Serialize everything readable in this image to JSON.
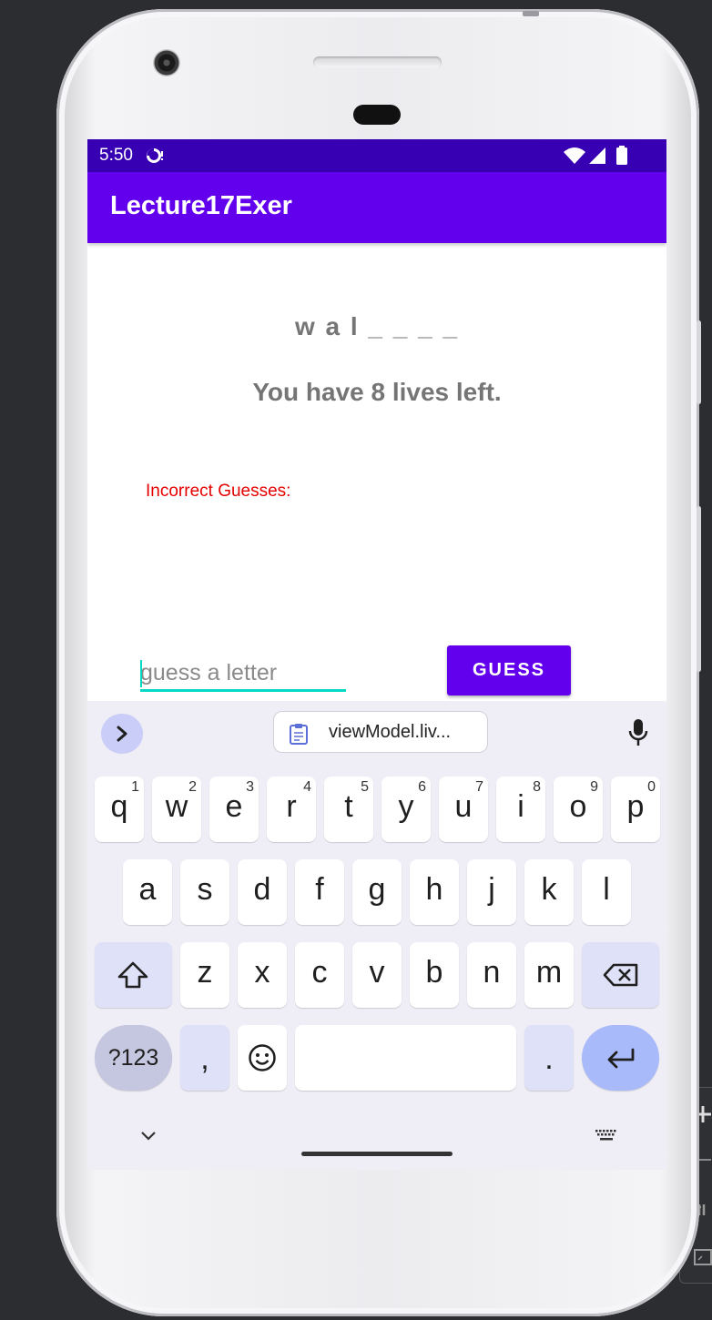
{
  "status_bar": {
    "time": "5:50"
  },
  "app_bar": {
    "title": "Lecture17Exer"
  },
  "game": {
    "word_display": "w a l _ _ _ _",
    "lives_text": "You have 8 lives left.",
    "incorrect_label": "Incorrect Guesses:"
  },
  "guess": {
    "placeholder": "guess a letter",
    "value": "",
    "button_label": "GUESS"
  },
  "keyboard": {
    "clipboard_suggestion": "viewModel.liv...",
    "row1": [
      {
        "char": "q",
        "hint": "1"
      },
      {
        "char": "w",
        "hint": "2"
      },
      {
        "char": "e",
        "hint": "3"
      },
      {
        "char": "r",
        "hint": "4"
      },
      {
        "char": "t",
        "hint": "5"
      },
      {
        "char": "y",
        "hint": "6"
      },
      {
        "char": "u",
        "hint": "7"
      },
      {
        "char": "i",
        "hint": "8"
      },
      {
        "char": "o",
        "hint": "9"
      },
      {
        "char": "p",
        "hint": "0"
      }
    ],
    "row2": [
      "a",
      "s",
      "d",
      "f",
      "g",
      "h",
      "j",
      "k",
      "l"
    ],
    "row3": [
      "z",
      "x",
      "c",
      "v",
      "b",
      "n",
      "m"
    ],
    "symbols_label": "?123",
    "comma": ",",
    "period": "."
  },
  "colors": {
    "status_bar": "#3700b3",
    "primary": "#6200ee",
    "accent": "#03dac5",
    "incorrect_label": "#e50000"
  },
  "icons": {
    "status": [
      "data-saver-icon",
      "wifi-icon",
      "cell-signal-icon",
      "battery-icon"
    ],
    "keyboard": [
      "expand-toolbar-icon",
      "clipboard-icon",
      "mic-icon",
      "shift-icon",
      "backspace-icon",
      "emoji-icon",
      "enter-icon",
      "hide-keyboard-icon",
      "switch-keyboard-icon"
    ]
  }
}
